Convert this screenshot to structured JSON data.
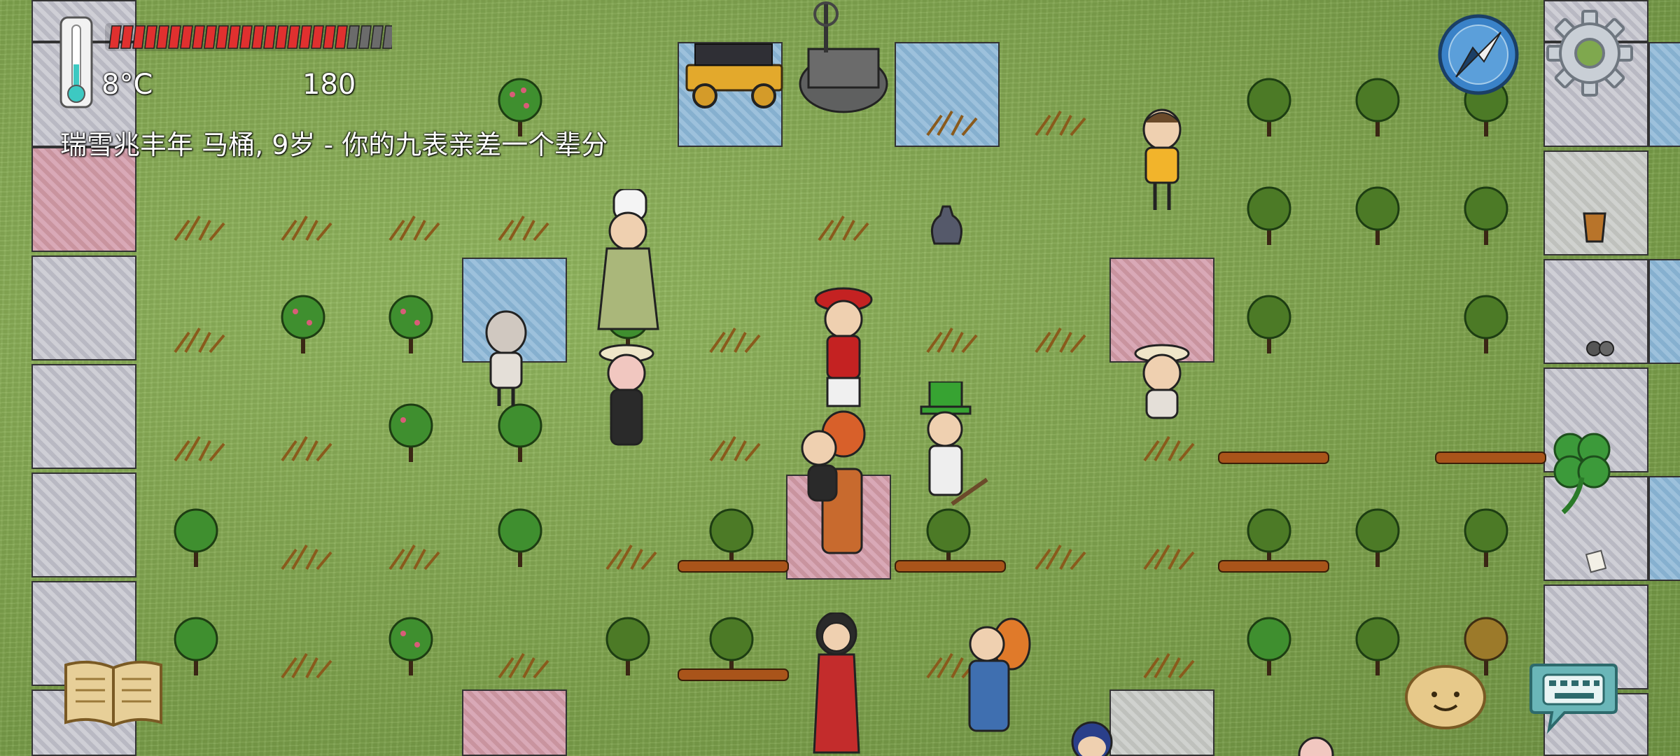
{
  "hud": {
    "temperature": "8°C",
    "counter": "180",
    "status_line": "瑞雪兆丰年 马桶, 9岁 - 你的九表亲差一个辈分",
    "health_fraction": 0.83
  },
  "icons": {
    "thermometer": "thermometer-icon",
    "compass": "compass-icon",
    "settings": "gear-icon",
    "clover": "four-leaf-clover-icon",
    "journal": "book-icon",
    "emote": "potato-face-icon",
    "keyboard": "keyboard-chat-icon"
  },
  "colors": {
    "grass": "#7ea24c",
    "health_bar": "#e0302f",
    "hud_text": "#ffffff"
  }
}
